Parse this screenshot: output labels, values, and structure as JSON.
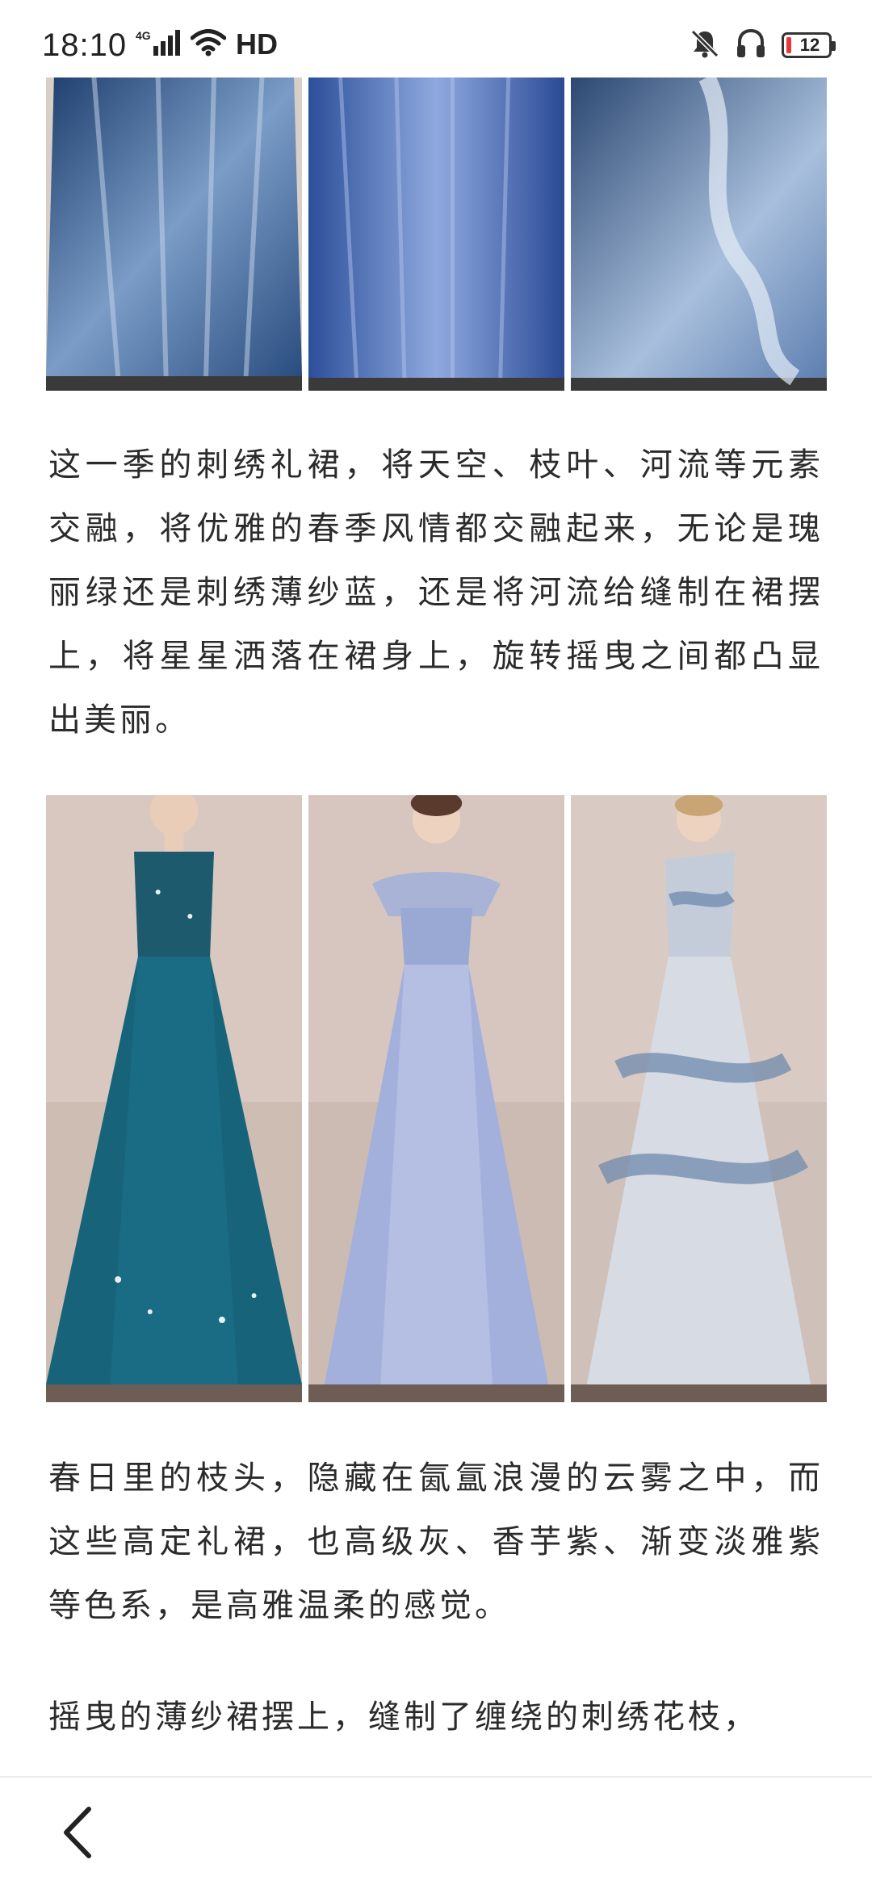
{
  "status_bar": {
    "time": "18:10",
    "network": "4G",
    "hd_label": "HD",
    "battery_level": "12",
    "battery_fraction": 0.12,
    "icons": [
      "signal-icon",
      "wifi-icon",
      "mute-icon",
      "headset-icon",
      "battery-icon"
    ]
  },
  "article": {
    "paragraphs": [
      "这一季的刺绣礼裙，将天空、枝叶、河流等元素交融，将优雅的春季风情都交融起来，无论是瑰丽绿还是刺绣薄纱蓝，还是将河流给缝制在裙摆上，将星星洒落在裙身上，旋转摇曳之间都凸显出美丽。",
      "春日里的枝头，隐藏在氤氲浪漫的云雾之中，而这些高定礼裙，也高级灰、香芋紫、渐变淡雅紫等色系，是高雅温柔的感觉。",
      "摇曳的薄纱裙摆上，缝制了缠绕的刺绣花枝，"
    ]
  },
  "galleries": {
    "top": [
      "blue-lace-gown-skirt-photo",
      "blue-tulle-gown-skirt-photo",
      "blue-ruffle-gown-skirt-photo"
    ],
    "middle": [
      "teal-star-gown-photo",
      "lavender-lace-gown-photo",
      "silver-wave-gown-photo"
    ]
  },
  "colors": {
    "text": "#2b2b2b",
    "battery_low": "#e53935",
    "background": "#ffffff"
  },
  "nav": {
    "back_icon": "chevron-left-icon"
  }
}
